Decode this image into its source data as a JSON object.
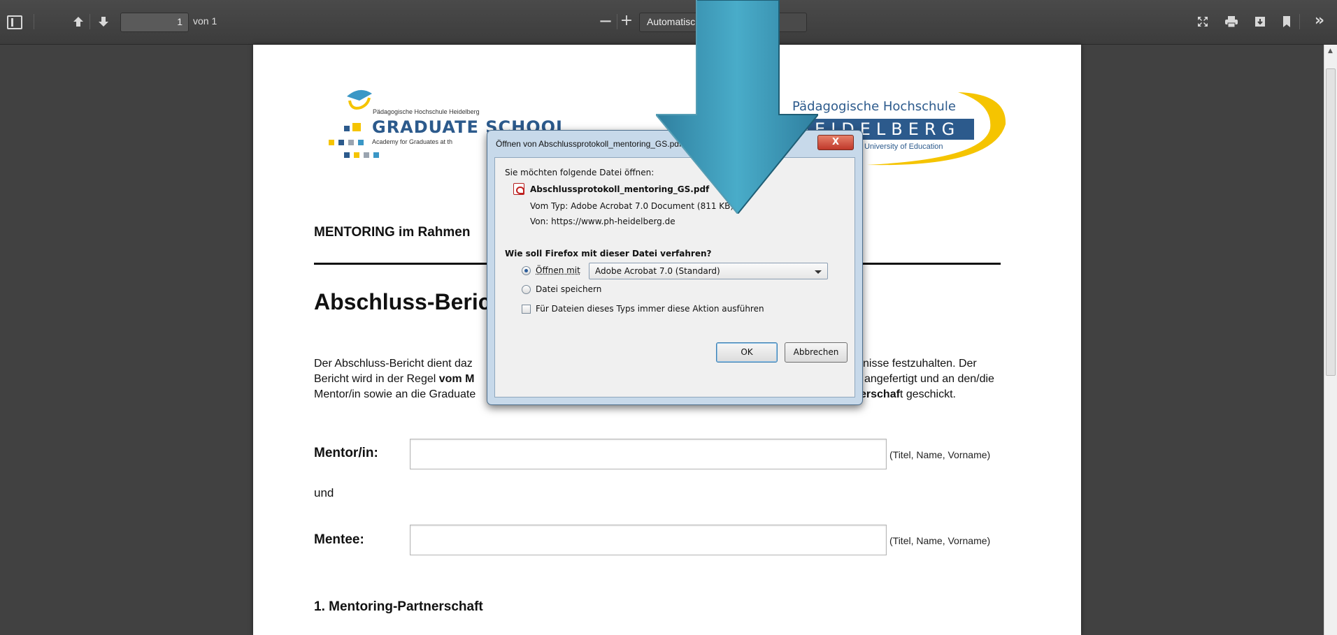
{
  "toolbar": {
    "page_current": "1",
    "page_of": "von 1",
    "zoom_minus": "—",
    "zoom_plus": "+",
    "zoom_select": "Automatischer Zoom",
    "icons": [
      "sidebar-toggle-icon",
      "arrow-up-icon",
      "arrow-down-icon",
      "zoom-out-icon",
      "zoom-in-icon",
      "fullscreen-icon",
      "print-icon",
      "download-icon",
      "bookmark-icon",
      "tools-icon"
    ]
  },
  "document": {
    "gs_logo": {
      "small": "Pädagogische Hochschule Heidelberg",
      "big": "GRADUATE SCHOOL",
      "academy": "Academy for Graduates at th"
    },
    "ph_logo": {
      "title": "Pädagogische Hochschule",
      "name": "HEIDELBERG",
      "uni": "University of Education"
    },
    "mentoring_heading": "MENTORING im Rahmen",
    "title": "Abschluss-Beric",
    "paragraph": {
      "line1_left": "Der Abschluss-Bericht dient daz",
      "line1_right": "nisse festzuhalten. Der",
      "line2_left_plain": "Bericht wird in der Regel ",
      "line2_left_bold": "vom M",
      "line2_right": "angefertigt und an den/die",
      "line3_left": "Mentor/in sowie an die Graduate",
      "line3_right_bold": "erschaf",
      "line3_right_plain": "t geschickt."
    },
    "mentor_label": "Mentor/in:",
    "mentor_hint": "(Titel, Name, Vorname)",
    "und": "und",
    "mentee_label": "Mentee:",
    "mentee_hint": "(Titel, Name, Vorname)",
    "section1": "1.  Mentoring-Partnerschaft"
  },
  "dialog": {
    "title": "Öffnen von Abschlussprotokoll_mentoring_GS.pdf",
    "close": "X",
    "intro": "Sie möchten folgende Datei öffnen:",
    "filename": "Abschlussprotokoll_mentoring_GS.pdf",
    "type": "Vom Typ:  Adobe Acrobat 7.0 Document (811 KB)",
    "from": "Von:  https://www.ph-heidelberg.de",
    "question": "Wie soll Firefox mit dieser Datei verfahren?",
    "open_with_label": "Öffnen mit",
    "open_with_value": "Adobe Acrobat 7.0 (Standard)",
    "save_label": "Datei speichern",
    "always_label": "Für Dateien dieses Typs immer diese Aktion ausführen",
    "ok": "OK",
    "cancel": "Abbrechen",
    "selected_option": "open_with"
  },
  "colors": {
    "toolbar_bg": "#404040",
    "viewer_bg": "#414141",
    "page_bg": "#ffffff",
    "brand_blue": "#2c5a8c",
    "brand_yellow": "#f5c400",
    "arrow_teal": "#3a97b6",
    "dialog_frame": "#c7d9ea"
  }
}
